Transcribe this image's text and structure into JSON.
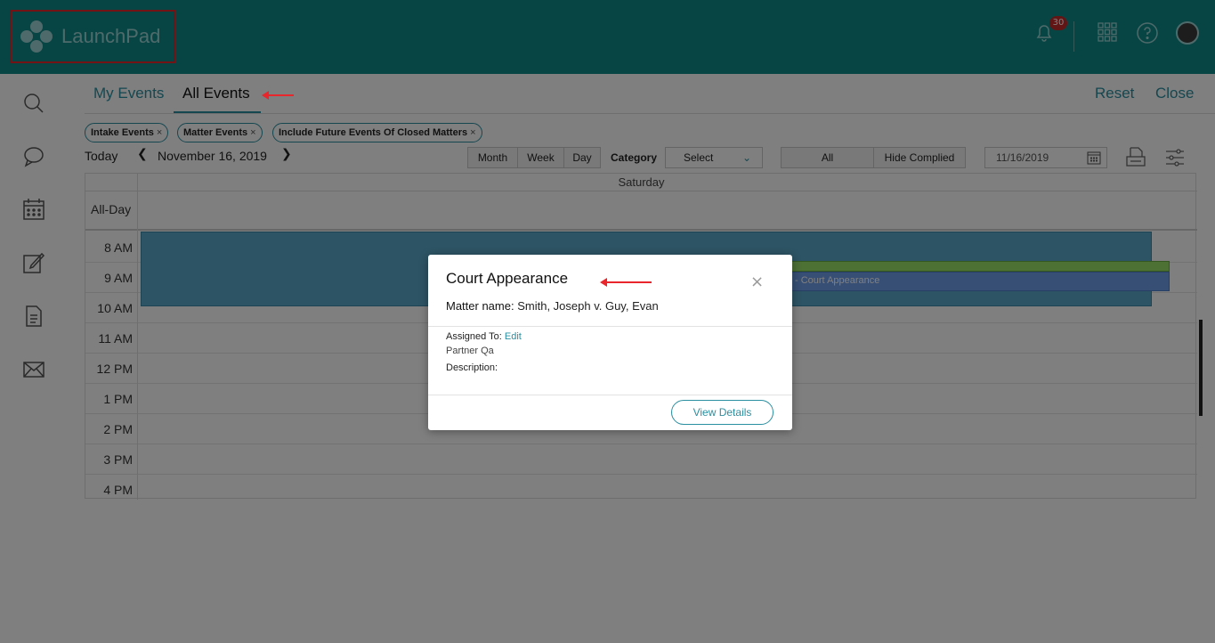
{
  "app": {
    "name": "LaunchPad",
    "notification_count": "30"
  },
  "tabs": {
    "my_events": "My Events",
    "all_events": "All Events"
  },
  "actions": {
    "reset": "Reset",
    "close": "Close"
  },
  "filters": [
    "Intake Events",
    "Matter Events",
    "Include Future Events Of Closed Matters"
  ],
  "toolbar": {
    "today": "Today",
    "date": "November 16, 2019",
    "views": [
      "Month",
      "Week",
      "Day"
    ],
    "category_label": "Category",
    "category_value": "Select",
    "status": [
      "All",
      "Hide Complied"
    ],
    "date_input": "11/16/2019"
  },
  "calendar": {
    "day_header": "Saturday",
    "all_day_label": "All-Day",
    "hours": [
      "8 AM",
      "9 AM",
      "10 AM",
      "11 AM",
      "12 PM",
      "1 PM",
      "2 PM",
      "3 PM",
      "4 PM"
    ],
    "event_text": "- Court Appearance"
  },
  "modal": {
    "title": "Court Appearance",
    "matter_label": "Matter name:",
    "matter_value": "Smith, Joseph v. Guy, Evan",
    "assigned_label": "Assigned To:",
    "edit": "Edit",
    "assignee": "Partner Qa",
    "description_label": "Description:",
    "view_details": "View Details",
    "close_symbol": "×"
  },
  "colors": {
    "header": "#0f8a8a",
    "accent": "#2a8fa0",
    "annotation": "#e8262b"
  }
}
